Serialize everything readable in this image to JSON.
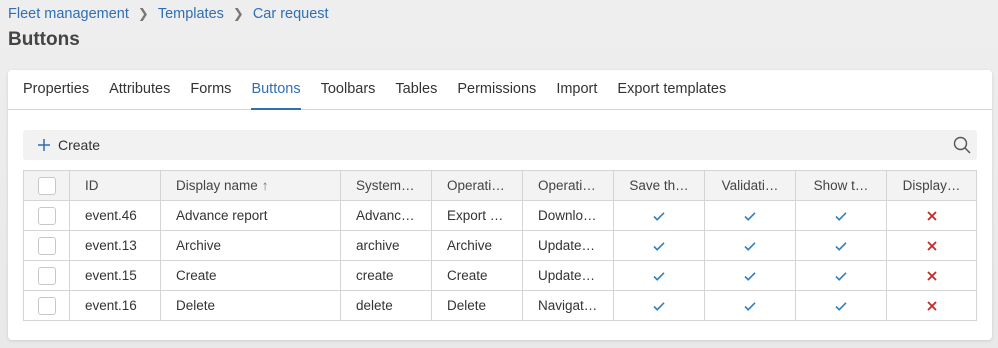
{
  "breadcrumb": {
    "items": [
      "Fleet management",
      "Templates",
      "Car request"
    ]
  },
  "page": {
    "title": "Buttons"
  },
  "tabs": {
    "items": [
      "Properties",
      "Attributes",
      "Forms",
      "Buttons",
      "Toolbars",
      "Tables",
      "Permissions",
      "Import",
      "Export templates"
    ],
    "active": "Buttons"
  },
  "toolbar": {
    "create_label": "Create"
  },
  "table": {
    "columns": [
      "ID",
      "Display name",
      "System…",
      "Operati…",
      "Operati…",
      "Save th…",
      "Validati…",
      "Show t…",
      "Display…"
    ],
    "sort_indicator": "↑",
    "rows": [
      {
        "id": "event.46",
        "display_name": "Advance report",
        "system": "Advanc…",
        "operation1": "Export …",
        "operation2": "Downlo…",
        "save": true,
        "validate": true,
        "show": true,
        "display": false
      },
      {
        "id": "event.13",
        "display_name": "Archive",
        "system": "archive",
        "operation1": "Archive",
        "operation2": "Update …",
        "save": true,
        "validate": true,
        "show": true,
        "display": false
      },
      {
        "id": "event.15",
        "display_name": "Create",
        "system": "create",
        "operation1": "Create",
        "operation2": "Update …",
        "save": true,
        "validate": true,
        "show": true,
        "display": false
      },
      {
        "id": "event.16",
        "display_name": "Delete",
        "system": "delete",
        "operation1": "Delete",
        "operation2": "Navigati…",
        "save": true,
        "validate": true,
        "show": true,
        "display": false
      }
    ]
  },
  "colors": {
    "accent": "#2f6fb3",
    "check": "#2f80c0",
    "cross": "#c62828"
  }
}
